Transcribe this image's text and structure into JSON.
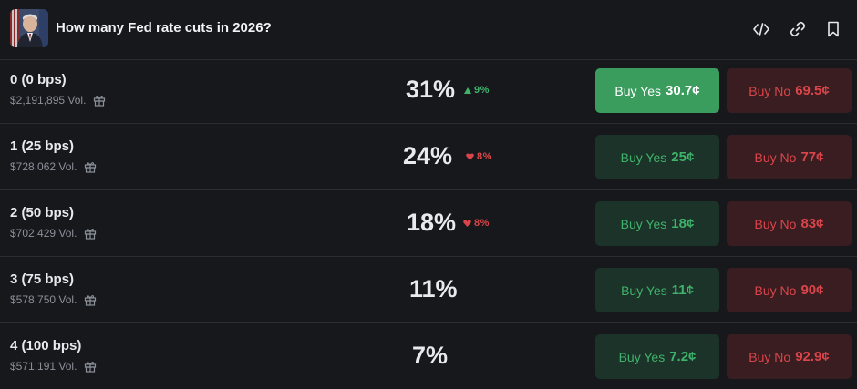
{
  "header": {
    "title": "How many Fed rate cuts in 2026?",
    "icons": [
      "code-icon",
      "link-icon",
      "bookmark-icon"
    ]
  },
  "colors": {
    "background": "#16181c",
    "up": "#3fb36b",
    "down": "#d9454a",
    "yes_active_bg": "#3a9d5d",
    "yes_bg": "#1b3328",
    "no_bg": "#3a1d20"
  },
  "outcomes": [
    {
      "name": "0 (0 bps)",
      "volume": "$2,191,895 Vol.",
      "probability": "31%",
      "change": "9%",
      "direction": "up",
      "yes_label": "Buy Yes",
      "yes_price": "30.7¢",
      "no_label": "Buy No",
      "no_price": "69.5¢",
      "yes_active": true
    },
    {
      "name": "1 (25 bps)",
      "volume": "$728,062 Vol.",
      "probability": "24%",
      "change": "8%",
      "direction": "down",
      "yes_label": "Buy Yes",
      "yes_price": "25¢",
      "no_label": "Buy No",
      "no_price": "77¢",
      "yes_active": false
    },
    {
      "name": "2 (50 bps)",
      "volume": "$702,429 Vol.",
      "probability": "18%",
      "change": "8%",
      "direction": "down",
      "yes_label": "Buy Yes",
      "yes_price": "18¢",
      "no_label": "Buy No",
      "no_price": "83¢",
      "yes_active": false
    },
    {
      "name": "3 (75 bps)",
      "volume": "$578,750 Vol.",
      "probability": "11%",
      "change": "",
      "direction": "none",
      "yes_label": "Buy Yes",
      "yes_price": "11¢",
      "no_label": "Buy No",
      "no_price": "90¢",
      "yes_active": false
    },
    {
      "name": "4 (100 bps)",
      "volume": "$571,191 Vol.",
      "probability": "7%",
      "change": "",
      "direction": "none",
      "yes_label": "Buy Yes",
      "yes_price": "7.2¢",
      "no_label": "Buy No",
      "no_price": "92.9¢",
      "yes_active": false
    }
  ]
}
